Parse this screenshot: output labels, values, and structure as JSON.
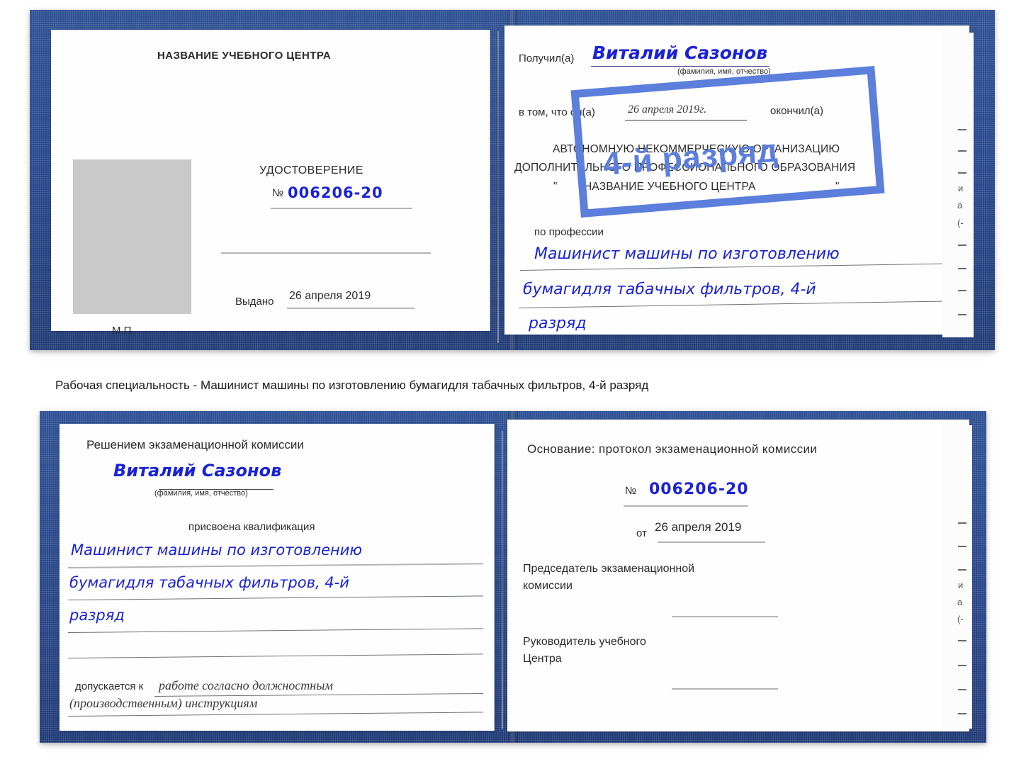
{
  "document": {
    "type": "certificate-scan",
    "language": "ru",
    "caption": "Рабочая специальность - Машинист машины по изготовлению бумагидля табачных фильтров, 4-й разряд"
  },
  "colors": {
    "cover_blue": "#27468a",
    "stamp_blue": "#5b7fdb",
    "ink_blue": "#1a22d8",
    "paper": "#fefefe",
    "photo_placeholder": "#c9c9c9",
    "rule_gray": "#b5b5b5"
  },
  "certificate_top": {
    "left_page": {
      "heading": "НАЗВАНИЕ УЧЕБНОГО ЦЕНТРА",
      "doc_title": "УДОСТОВЕРЕНИЕ",
      "number_label": "№",
      "number_value": "006206-20",
      "issued_label": "Выдано",
      "issued_value": "26 апреля 2019",
      "seal_label": "М.П.",
      "photo_placeholder_label": "photo"
    },
    "right_page": {
      "received_label": "Получил(а)",
      "received_name": "Виталий Сазонов",
      "name_hint": "(фамилия, имя, отчество)",
      "clause_prefix": "в том, что он(а)",
      "clause_date": "26 апреля 2019г.",
      "clause_suffix": "окончил(а)",
      "org_line1": "АВТОНОМНУЮ НЕКОММЕРЧЕСКУЮ ОРГАНИЗАЦИЮ",
      "org_line2": "ДОПОЛНИТЕЛЬНОГО ПРОФЕССИОНАЛЬНОГО ОБРАЗОВАНИЯ",
      "org_quote_open": "\"",
      "org_name": "НАЗВАНИЕ УЧЕБНОГО ЦЕНТРА",
      "org_quote_close": "\"",
      "profession_label": "по профессии",
      "profession_line1": "Машинист машины по изготовлению",
      "profession_line2": "бумагидля табачных фильтров, 4-й",
      "profession_line3": "разряд",
      "stamp_text": "4-й разряд"
    }
  },
  "certificate_bottom": {
    "left_page": {
      "heading": "Решением экзаменационной комиссии",
      "name": "Виталий Сазонов",
      "name_hint": "(фамилия, имя, отчество)",
      "qualification_label": "присвоена квалификация",
      "qualification_line1": "Машинист машины по изготовлению",
      "qualification_line2": "бумагидля табачных фильтров, 4-й",
      "qualification_line3": "разряд",
      "admitted_label": "допускается к",
      "admitted_value_line1": "работе согласно должностным",
      "admitted_value_line2": "(производственным) инструкциям"
    },
    "right_page": {
      "basis_label": "Основание: протокол экзаменационной комиссии",
      "number_label": "№",
      "number_value": "006206-20",
      "date_label": "от",
      "date_value": "26 апреля 2019",
      "chairman_line1": "Председатель экзаменационной",
      "chairman_line2": "комиссии",
      "head_line1": "Руководитель учебного",
      "head_line2": "Центра"
    }
  },
  "edge_marks": {
    "glyphs": [
      "–",
      "–",
      "–",
      "и",
      "а",
      "(-",
      "–",
      "–",
      "–",
      "–"
    ]
  }
}
